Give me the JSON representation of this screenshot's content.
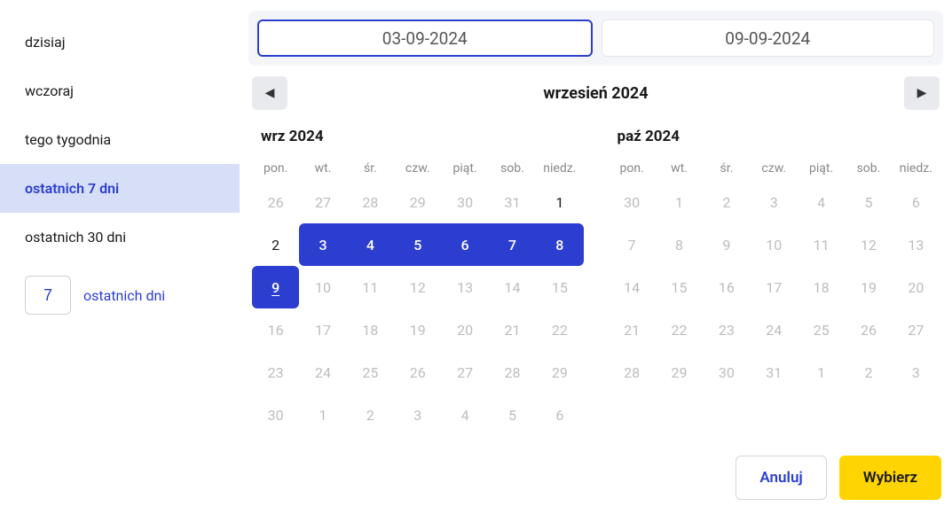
{
  "sidebar": {
    "presets": [
      {
        "label": "dzisiaj",
        "active": false
      },
      {
        "label": "wczoraj",
        "active": false
      },
      {
        "label": "tego tygodnia",
        "active": false
      },
      {
        "label": "ostatnich 7 dni",
        "active": true
      },
      {
        "label": "ostatnich 30 dni",
        "active": false
      }
    ],
    "custom": {
      "value": "7",
      "suffix": "ostatnich dni"
    }
  },
  "inputs": {
    "from": "03-09-2024",
    "to": "09-09-2024"
  },
  "nav": {
    "title": "wrzesień 2024"
  },
  "weekdays": [
    "pon.",
    "wt.",
    "śr.",
    "czw.",
    "piąt.",
    "sob.",
    "niedz."
  ],
  "cal_left": {
    "title": "wrz 2024",
    "rows": [
      [
        {
          "n": "26",
          "cls": "inactive"
        },
        {
          "n": "27",
          "cls": "inactive"
        },
        {
          "n": "28",
          "cls": "inactive"
        },
        {
          "n": "29",
          "cls": "inactive"
        },
        {
          "n": "30",
          "cls": "inactive"
        },
        {
          "n": "31",
          "cls": "inactive"
        },
        {
          "n": "1",
          "cls": "normal"
        }
      ],
      [
        {
          "n": "2",
          "cls": "normal"
        },
        {
          "n": "3",
          "cls": "range start"
        },
        {
          "n": "4",
          "cls": "range"
        },
        {
          "n": "5",
          "cls": "range"
        },
        {
          "n": "6",
          "cls": "range"
        },
        {
          "n": "7",
          "cls": "range"
        },
        {
          "n": "8",
          "cls": "range end"
        }
      ],
      [
        {
          "n": "9",
          "cls": "today"
        },
        {
          "n": "10",
          "cls": "inactive"
        },
        {
          "n": "11",
          "cls": "inactive"
        },
        {
          "n": "12",
          "cls": "inactive"
        },
        {
          "n": "13",
          "cls": "inactive"
        },
        {
          "n": "14",
          "cls": "inactive"
        },
        {
          "n": "15",
          "cls": "inactive"
        }
      ],
      [
        {
          "n": "16",
          "cls": "inactive"
        },
        {
          "n": "17",
          "cls": "inactive"
        },
        {
          "n": "18",
          "cls": "inactive"
        },
        {
          "n": "19",
          "cls": "inactive"
        },
        {
          "n": "20",
          "cls": "inactive"
        },
        {
          "n": "21",
          "cls": "inactive"
        },
        {
          "n": "22",
          "cls": "inactive"
        }
      ],
      [
        {
          "n": "23",
          "cls": "inactive"
        },
        {
          "n": "24",
          "cls": "inactive"
        },
        {
          "n": "25",
          "cls": "inactive"
        },
        {
          "n": "26",
          "cls": "inactive"
        },
        {
          "n": "27",
          "cls": "inactive"
        },
        {
          "n": "28",
          "cls": "inactive"
        },
        {
          "n": "29",
          "cls": "inactive"
        }
      ],
      [
        {
          "n": "30",
          "cls": "inactive"
        },
        {
          "n": "1",
          "cls": "inactive"
        },
        {
          "n": "2",
          "cls": "inactive"
        },
        {
          "n": "3",
          "cls": "inactive"
        },
        {
          "n": "4",
          "cls": "inactive"
        },
        {
          "n": "5",
          "cls": "inactive"
        },
        {
          "n": "6",
          "cls": "inactive"
        }
      ]
    ]
  },
  "cal_right": {
    "title": "paź 2024",
    "rows": [
      [
        {
          "n": "30",
          "cls": "inactive"
        },
        {
          "n": "1",
          "cls": "inactive"
        },
        {
          "n": "2",
          "cls": "inactive"
        },
        {
          "n": "3",
          "cls": "inactive"
        },
        {
          "n": "4",
          "cls": "inactive"
        },
        {
          "n": "5",
          "cls": "inactive"
        },
        {
          "n": "6",
          "cls": "inactive"
        }
      ],
      [
        {
          "n": "7",
          "cls": "inactive"
        },
        {
          "n": "8",
          "cls": "inactive"
        },
        {
          "n": "9",
          "cls": "inactive"
        },
        {
          "n": "10",
          "cls": "inactive"
        },
        {
          "n": "11",
          "cls": "inactive"
        },
        {
          "n": "12",
          "cls": "inactive"
        },
        {
          "n": "13",
          "cls": "inactive"
        }
      ],
      [
        {
          "n": "14",
          "cls": "inactive"
        },
        {
          "n": "15",
          "cls": "inactive"
        },
        {
          "n": "16",
          "cls": "inactive"
        },
        {
          "n": "17",
          "cls": "inactive"
        },
        {
          "n": "18",
          "cls": "inactive"
        },
        {
          "n": "19",
          "cls": "inactive"
        },
        {
          "n": "20",
          "cls": "inactive"
        }
      ],
      [
        {
          "n": "21",
          "cls": "inactive"
        },
        {
          "n": "22",
          "cls": "inactive"
        },
        {
          "n": "23",
          "cls": "inactive"
        },
        {
          "n": "24",
          "cls": "inactive"
        },
        {
          "n": "25",
          "cls": "inactive"
        },
        {
          "n": "26",
          "cls": "inactive"
        },
        {
          "n": "27",
          "cls": "inactive"
        }
      ],
      [
        {
          "n": "28",
          "cls": "inactive"
        },
        {
          "n": "29",
          "cls": "inactive"
        },
        {
          "n": "30",
          "cls": "inactive"
        },
        {
          "n": "31",
          "cls": "inactive"
        },
        {
          "n": "1",
          "cls": "inactive"
        },
        {
          "n": "2",
          "cls": "inactive"
        },
        {
          "n": "3",
          "cls": "inactive"
        }
      ]
    ]
  },
  "footer": {
    "cancel": "Anuluj",
    "select": "Wybierz"
  }
}
